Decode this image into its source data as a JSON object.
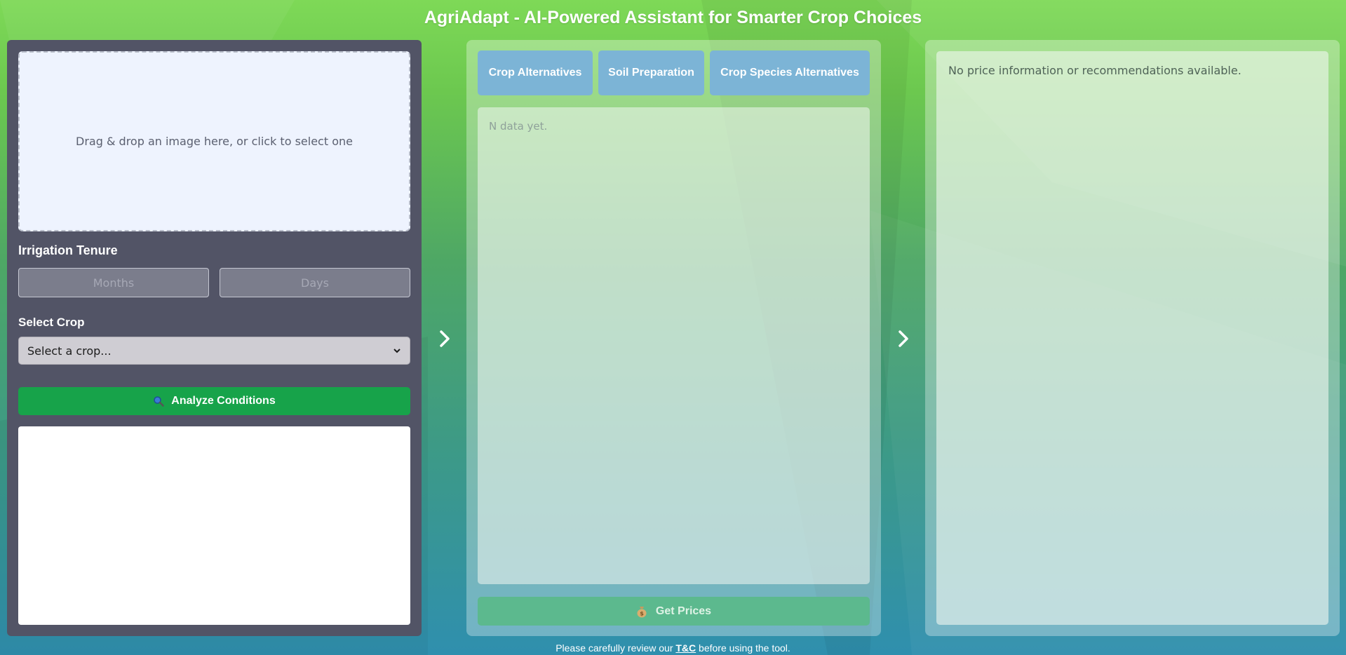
{
  "header": {
    "title": "AgriAdapt - AI-Powered Assistant for Smarter Crop Choices"
  },
  "left_panel": {
    "dropzone_text": "Drag & drop an image here, or click to select one",
    "irrigation_label": "Irrigation Tenure",
    "months_placeholder": "Months",
    "days_placeholder": "Days",
    "select_crop_label": "Select Crop",
    "select_crop_value": "Select a crop...",
    "analyze_button": {
      "icon": "magnifier-icon",
      "label": "Analyze Conditions"
    }
  },
  "middle_panel": {
    "tabs": [
      {
        "label": "Crop Alternatives"
      },
      {
        "label": "Soil Preparation"
      },
      {
        "label": "Crop Species Alternatives"
      }
    ],
    "content_text": "N data yet.",
    "prices_button": {
      "icon": "money-bag-icon",
      "label": "Get Prices"
    }
  },
  "right_panel": {
    "info_text": "No price information or recommendations available."
  },
  "footer": {
    "text_before": "Please carefully review our",
    "link": "T&C",
    "text_after": "before using the tool."
  },
  "colors": {
    "left_panel_bg": "#525466",
    "analyze_green": "#17a34a",
    "tab_blue": "#7cb4d6",
    "prices_green": "#5cb98e"
  }
}
